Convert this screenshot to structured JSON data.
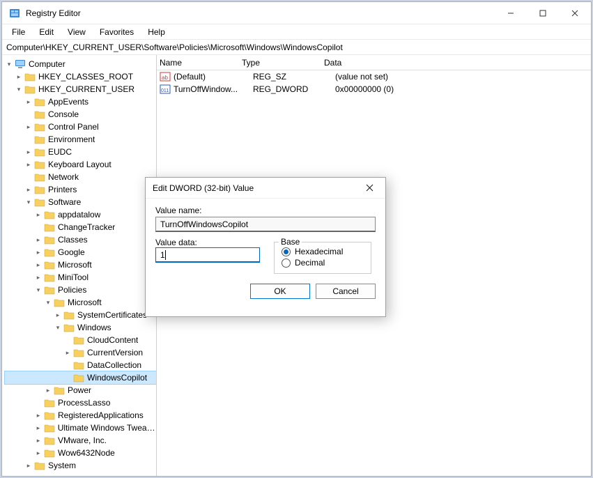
{
  "window": {
    "title": "Registry Editor",
    "menus": {
      "file": "File",
      "edit": "Edit",
      "view": "View",
      "favorites": "Favorites",
      "help": "Help"
    },
    "address": "Computer\\HKEY_CURRENT_USER\\Software\\Policies\\Microsoft\\Windows\\WindowsCopilot"
  },
  "tree": {
    "root": "Computer",
    "hkcr": "HKEY_CLASSES_ROOT",
    "hkcu": "HKEY_CURRENT_USER",
    "hkcu_children": {
      "appevents": "AppEvents",
      "console": "Console",
      "controlpanel": "Control Panel",
      "environment": "Environment",
      "eudc": "EUDC",
      "keyboard": "Keyboard Layout",
      "network": "Network",
      "printers": "Printers",
      "software": "Software",
      "software_children": {
        "appdatalow": "appdatalow",
        "changetracker": "ChangeTracker",
        "classes": "Classes",
        "google": "Google",
        "microsoft": "Microsoft",
        "minitool": "MiniTool",
        "policies": "Policies",
        "policies_children": {
          "microsoft": "Microsoft",
          "microsoft_children": {
            "systemcert": "SystemCertificates",
            "windows": "Windows",
            "windows_children": {
              "cloudcontent": "CloudContent",
              "currentversion": "CurrentVersion",
              "datacollection": "DataCollection",
              "windowscopilot": "WindowsCopilot"
            }
          },
          "power": "Power"
        },
        "processlasso": "ProcessLasso",
        "registeredapps": "RegisteredApplications",
        "uwt": "Ultimate Windows Tweaker",
        "vmware": "VMware, Inc.",
        "wow64": "Wow6432Node"
      },
      "system": "System"
    }
  },
  "list": {
    "headers": {
      "name": "Name",
      "type": "Type",
      "data": "Data"
    },
    "rows": [
      {
        "name": "(Default)",
        "type": "REG_SZ",
        "data": "(value not set)",
        "icon": "string"
      },
      {
        "name": "TurnOffWindow...",
        "type": "REG_DWORD",
        "data": "0x00000000 (0)",
        "icon": "binary"
      }
    ]
  },
  "dialog": {
    "title": "Edit DWORD (32-bit) Value",
    "value_name_label": "Value name:",
    "value_name": "TurnOffWindowsCopilot",
    "value_data_label": "Value data:",
    "value_data": "1",
    "base_label": "Base",
    "hex_label": "Hexadecimal",
    "dec_label": "Decimal",
    "base_selected": "hex",
    "ok": "OK",
    "cancel": "Cancel"
  }
}
